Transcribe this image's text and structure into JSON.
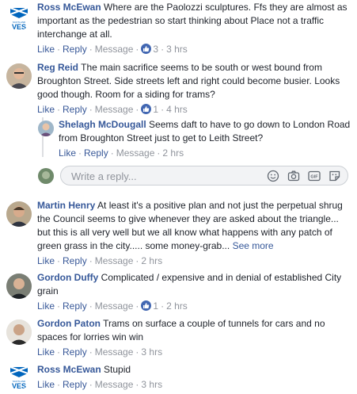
{
  "comments": [
    {
      "author": "Ross McEwan",
      "text": "Where are the Paolozzi sculptures. Ffs they are almost as important as the pedestrian so start thinking about Place not a traffic interchange at all.",
      "like": "Like",
      "reply": "Reply",
      "message": "Message",
      "likes": "3",
      "time": "3 hrs",
      "avatar": "yes-scotland-logo-avatar"
    },
    {
      "author": "Reg Reid",
      "text": "The main sacrifice seems to be south or west bound from Broughton Street. Side streets left and right could become busier. Looks good though. Room for a siding for trams?",
      "like": "Like",
      "reply": "Reply",
      "message": "Message",
      "likes": "1",
      "time": "4 hrs",
      "avatar": "photo-avatar"
    },
    {
      "author": "Shelagh McDougall",
      "text": "Seems daft to have to go down to London Road from Broughton Street just to get to Leith Street?",
      "like": "Like",
      "reply": "Reply",
      "message": "Message",
      "time": "2 hrs",
      "avatar": "photo-avatar"
    },
    {
      "author": "Martin Henry",
      "text": "At least it's a positive plan and not just the perpetual shrug the Council seems to give whenever they are asked about the triangle... but this is all very well but we all know what happens with any patch of green grass in the city..... some money-grab...",
      "see_more": "See more",
      "like": "Like",
      "reply": "Reply",
      "message": "Message",
      "time": "2 hrs",
      "avatar": "photo-avatar"
    },
    {
      "author": "Gordon Duffy",
      "text": "Complicated / expensive and in denial of established City grain",
      "like": "Like",
      "reply": "Reply",
      "message": "Message",
      "likes": "1",
      "time": "2 hrs",
      "avatar": "photo-avatar"
    },
    {
      "author": "Gordon Paton",
      "text": "Trams on surface a couple of tunnels for cars and no spaces for lorries win win",
      "like": "Like",
      "reply": "Reply",
      "message": "Message",
      "time": "3 hrs",
      "avatar": "photo-avatar"
    },
    {
      "author": "Ross McEwan",
      "text": "Stupid",
      "like": "Like",
      "reply": "Reply",
      "message": "Message",
      "time": "3 hrs",
      "avatar": "yes-scotland-logo-avatar"
    }
  ],
  "reply_box": {
    "placeholder": "Write a reply...",
    "icons": [
      "emoji-icon",
      "camera-icon",
      "gif-icon",
      "sticker-icon"
    ]
  },
  "colors": {
    "link": "#365899",
    "like_badge": "#4267b2",
    "meta": "#90949c"
  }
}
